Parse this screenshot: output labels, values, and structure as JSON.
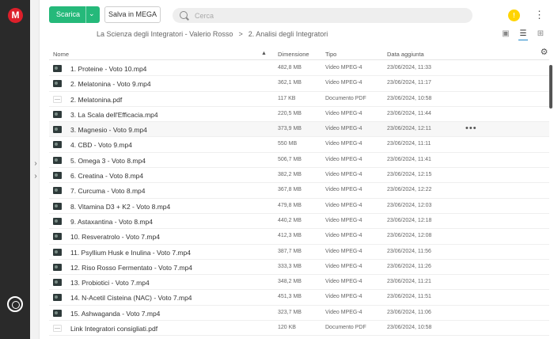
{
  "app": {
    "logo": "M"
  },
  "toolbar": {
    "download_label": "Scarica",
    "save_label": "Salva in MEGA",
    "search_placeholder": "Cerca",
    "avatar_letter": "!",
    "menu_icon": "kebab-icon"
  },
  "breadcrumb": {
    "root": "La Scienza degli Integratori - Valerio Rosso",
    "separator": ">",
    "current": "2. Analisi degli Integratori"
  },
  "columns": {
    "name": "Nome",
    "size": "Dimensione",
    "type": "Tipo",
    "date": "Data aggiunta"
  },
  "files": [
    {
      "name": "1. Proteine - Voto 10.mp4",
      "size": "482,8 MB",
      "type": "Video MPEG-4",
      "date": "23/06/2024, 11:33",
      "kind": "video"
    },
    {
      "name": "2. Melatonina - Voto 9.mp4",
      "size": "362,1 MB",
      "type": "Video MPEG-4",
      "date": "23/06/2024, 11:17",
      "kind": "video"
    },
    {
      "name": "2. Melatonina.pdf",
      "size": "117 KB",
      "type": "Documento PDF",
      "date": "23/06/2024, 10:58",
      "kind": "pdf"
    },
    {
      "name": "3. La Scala dell'Efficacia.mp4",
      "size": "220,5 MB",
      "type": "Video MPEG-4",
      "date": "23/06/2024, 11:44",
      "kind": "video"
    },
    {
      "name": "3. Magnesio - Voto 9.mp4",
      "size": "373,9 MB",
      "type": "Video MPEG-4",
      "date": "23/06/2024, 12:11",
      "kind": "video"
    },
    {
      "name": "4. CBD - Voto 9.mp4",
      "size": "550 MB",
      "type": "Video MPEG-4",
      "date": "23/06/2024, 11:11",
      "kind": "video"
    },
    {
      "name": "5. Omega 3 - Voto 8.mp4",
      "size": "506,7 MB",
      "type": "Video MPEG-4",
      "date": "23/06/2024, 11:41",
      "kind": "video"
    },
    {
      "name": "6. Creatina - Voto 8.mp4",
      "size": "382,2 MB",
      "type": "Video MPEG-4",
      "date": "23/06/2024, 12:15",
      "kind": "video"
    },
    {
      "name": "7. Curcuma - Voto 8.mp4",
      "size": "367,8 MB",
      "type": "Video MPEG-4",
      "date": "23/06/2024, 12:22",
      "kind": "video"
    },
    {
      "name": "8. Vitamina D3 + K2 - Voto 8.mp4",
      "size": "479,8 MB",
      "type": "Video MPEG-4",
      "date": "23/06/2024, 12:03",
      "kind": "video"
    },
    {
      "name": "9. Astaxantina - Voto 8.mp4",
      "size": "440,2 MB",
      "type": "Video MPEG-4",
      "date": "23/06/2024, 12:18",
      "kind": "video"
    },
    {
      "name": "10. Resveratrolo - Voto 7.mp4",
      "size": "412,3 MB",
      "type": "Video MPEG-4",
      "date": "23/06/2024, 12:08",
      "kind": "video"
    },
    {
      "name": "11. Psyllium Husk e Inulina - Voto 7.mp4",
      "size": "387,7 MB",
      "type": "Video MPEG-4",
      "date": "23/06/2024, 11:56",
      "kind": "video"
    },
    {
      "name": "12. Riso Rosso Fermentato - Voto 7.mp4",
      "size": "333,3 MB",
      "type": "Video MPEG-4",
      "date": "23/06/2024, 11:26",
      "kind": "video"
    },
    {
      "name": "13. Probiotici - Voto 7.mp4",
      "size": "348,2 MB",
      "type": "Video MPEG-4",
      "date": "23/06/2024, 11:21",
      "kind": "video"
    },
    {
      "name": "14. N-Acetil Cisteina (NAC) - Voto 7.mp4",
      "size": "451,3 MB",
      "type": "Video MPEG-4",
      "date": "23/06/2024, 11:51",
      "kind": "video"
    },
    {
      "name": "15. Ashwaganda - Voto 7.mp4",
      "size": "323,7 MB",
      "type": "Video MPEG-4",
      "date": "23/06/2024, 11:06",
      "kind": "video"
    },
    {
      "name": "Link Integratori consigliati.pdf",
      "size": "120 KB",
      "type": "Documento PDF",
      "date": "23/06/2024, 10:58",
      "kind": "pdf"
    }
  ],
  "hovered_row": 4,
  "colors": {
    "accent": "#25b97a",
    "brand": "#dd1f2a",
    "rail": "#2a2a2a"
  }
}
